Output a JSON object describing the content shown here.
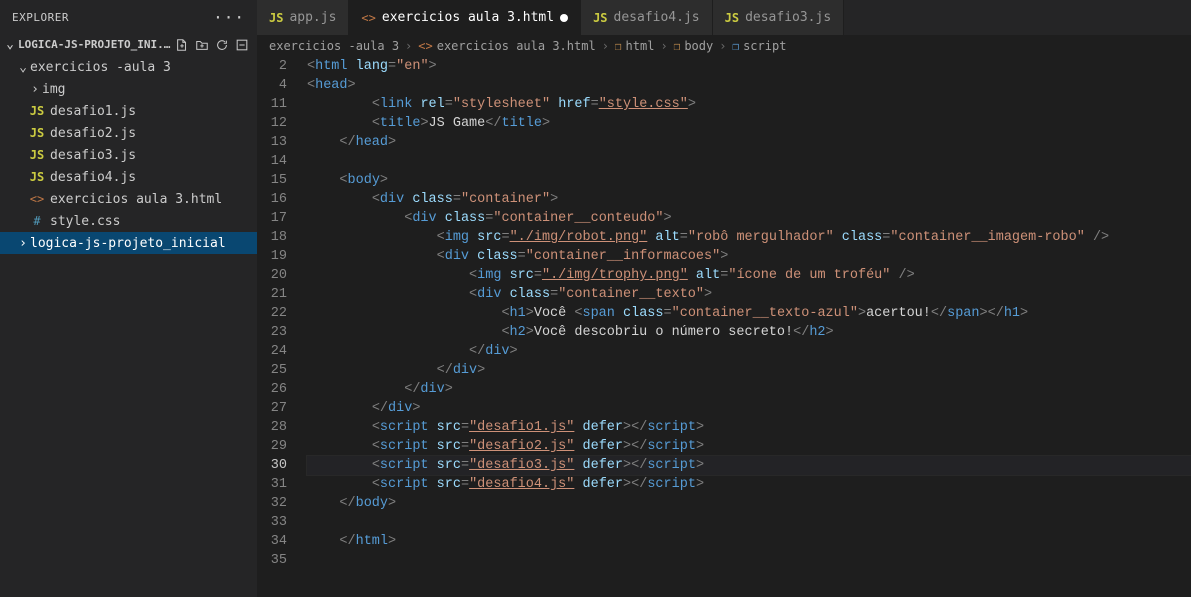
{
  "sidebar": {
    "title": "EXPLORER",
    "project": "LOGICA-JS-PROJETO_INI...",
    "folder": "exercicios -aula 3",
    "items": [
      {
        "label": "img",
        "type": "folder"
      },
      {
        "label": "desafio1.js",
        "type": "js"
      },
      {
        "label": "desafio2.js",
        "type": "js"
      },
      {
        "label": "desafio3.js",
        "type": "js"
      },
      {
        "label": "desafio4.js",
        "type": "js"
      },
      {
        "label": "exercicios aula 3.html",
        "type": "html"
      },
      {
        "label": "style.css",
        "type": "css"
      }
    ],
    "selected": "logica-js-projeto_inicial"
  },
  "tabs": [
    {
      "label": "app.js",
      "type": "js",
      "active": false,
      "dirty": false
    },
    {
      "label": "exercicios aula 3.html",
      "type": "html",
      "active": true,
      "dirty": true
    },
    {
      "label": "desafio4.js",
      "type": "js",
      "active": false,
      "dirty": false
    },
    {
      "label": "desafio3.js",
      "type": "js",
      "active": false,
      "dirty": false
    }
  ],
  "breadcrumbs": [
    {
      "label": "exercicios -aula 3",
      "icon": ""
    },
    {
      "label": "exercicios aula 3.html",
      "icon": "html"
    },
    {
      "label": "html",
      "icon": "cube"
    },
    {
      "label": "body",
      "icon": "cube"
    },
    {
      "label": "script",
      "icon": "cube-b"
    }
  ],
  "code": {
    "lineNumbers": [
      2,
      4,
      11,
      12,
      13,
      14,
      15,
      16,
      17,
      18,
      19,
      20,
      21,
      22,
      23,
      24,
      25,
      26,
      27,
      28,
      29,
      30,
      31,
      32,
      33,
      34,
      35
    ],
    "activeLine": 30,
    "lines": [
      {
        "n": 2,
        "tokens": [
          {
            "c": "punc",
            "t": "<"
          },
          {
            "c": "tag",
            "t": "html"
          },
          {
            "c": "txt",
            "t": " "
          },
          {
            "c": "attr",
            "t": "lang"
          },
          {
            "c": "punc",
            "t": "="
          },
          {
            "c": "string",
            "t": "\"en\""
          },
          {
            "c": "punc",
            "t": ">"
          }
        ]
      },
      {
        "n": 4,
        "tokens": [
          {
            "c": "punc",
            "t": "<"
          },
          {
            "c": "tag",
            "t": "head"
          },
          {
            "c": "punc",
            "t": ">"
          }
        ]
      },
      {
        "n": 11,
        "indent": 2,
        "tokens": [
          {
            "c": "punc",
            "t": "<"
          },
          {
            "c": "tag",
            "t": "link"
          },
          {
            "c": "txt",
            "t": " "
          },
          {
            "c": "attr",
            "t": "rel"
          },
          {
            "c": "punc",
            "t": "="
          },
          {
            "c": "string",
            "t": "\"stylesheet\""
          },
          {
            "c": "txt",
            "t": " "
          },
          {
            "c": "attr",
            "t": "href"
          },
          {
            "c": "punc",
            "t": "="
          },
          {
            "c": "string link",
            "t": "\"style.css\""
          },
          {
            "c": "punc",
            "t": ">"
          }
        ]
      },
      {
        "n": 12,
        "indent": 2,
        "tokens": [
          {
            "c": "punc",
            "t": "<"
          },
          {
            "c": "tag",
            "t": "title"
          },
          {
            "c": "punc",
            "t": ">"
          },
          {
            "c": "txt",
            "t": "JS Game"
          },
          {
            "c": "punc",
            "t": "</"
          },
          {
            "c": "tag",
            "t": "title"
          },
          {
            "c": "punc",
            "t": ">"
          }
        ]
      },
      {
        "n": 13,
        "indent": 1,
        "tokens": [
          {
            "c": "punc",
            "t": "</"
          },
          {
            "c": "tag",
            "t": "head"
          },
          {
            "c": "punc",
            "t": ">"
          }
        ]
      },
      {
        "n": 14,
        "tokens": []
      },
      {
        "n": 15,
        "indent": 1,
        "tokens": [
          {
            "c": "punc",
            "t": "<"
          },
          {
            "c": "tag",
            "t": "body"
          },
          {
            "c": "punc",
            "t": ">"
          }
        ]
      },
      {
        "n": 16,
        "indent": 2,
        "tokens": [
          {
            "c": "punc",
            "t": "<"
          },
          {
            "c": "tag",
            "t": "div"
          },
          {
            "c": "txt",
            "t": " "
          },
          {
            "c": "attr",
            "t": "class"
          },
          {
            "c": "punc",
            "t": "="
          },
          {
            "c": "string",
            "t": "\"container\""
          },
          {
            "c": "punc",
            "t": ">"
          }
        ]
      },
      {
        "n": 17,
        "indent": 3,
        "tokens": [
          {
            "c": "punc",
            "t": "<"
          },
          {
            "c": "tag",
            "t": "div"
          },
          {
            "c": "txt",
            "t": " "
          },
          {
            "c": "attr",
            "t": "class"
          },
          {
            "c": "punc",
            "t": "="
          },
          {
            "c": "string",
            "t": "\"container__conteudo\""
          },
          {
            "c": "punc",
            "t": ">"
          }
        ]
      },
      {
        "n": 18,
        "indent": 4,
        "tokens": [
          {
            "c": "punc",
            "t": "<"
          },
          {
            "c": "tag",
            "t": "img"
          },
          {
            "c": "txt",
            "t": " "
          },
          {
            "c": "attr",
            "t": "src"
          },
          {
            "c": "punc",
            "t": "="
          },
          {
            "c": "string link",
            "t": "\"./img/robot.png\""
          },
          {
            "c": "txt",
            "t": " "
          },
          {
            "c": "attr",
            "t": "alt"
          },
          {
            "c": "punc",
            "t": "="
          },
          {
            "c": "string",
            "t": "\"robô mergulhador\""
          },
          {
            "c": "txt",
            "t": " "
          },
          {
            "c": "attr",
            "t": "class"
          },
          {
            "c": "punc",
            "t": "="
          },
          {
            "c": "string",
            "t": "\"container__imagem-robo\""
          },
          {
            "c": "txt",
            "t": " "
          },
          {
            "c": "punc",
            "t": "/>"
          }
        ]
      },
      {
        "n": 19,
        "indent": 4,
        "tokens": [
          {
            "c": "punc",
            "t": "<"
          },
          {
            "c": "tag",
            "t": "div"
          },
          {
            "c": "txt",
            "t": " "
          },
          {
            "c": "attr",
            "t": "class"
          },
          {
            "c": "punc",
            "t": "="
          },
          {
            "c": "string",
            "t": "\"container__informacoes\""
          },
          {
            "c": "punc",
            "t": ">"
          }
        ]
      },
      {
        "n": 20,
        "indent": 5,
        "tokens": [
          {
            "c": "punc",
            "t": "<"
          },
          {
            "c": "tag",
            "t": "img"
          },
          {
            "c": "txt",
            "t": " "
          },
          {
            "c": "attr",
            "t": "src"
          },
          {
            "c": "punc",
            "t": "="
          },
          {
            "c": "string link",
            "t": "\"./img/trophy.png\""
          },
          {
            "c": "txt",
            "t": " "
          },
          {
            "c": "attr",
            "t": "alt"
          },
          {
            "c": "punc",
            "t": "="
          },
          {
            "c": "string",
            "t": "\"ícone de um troféu\""
          },
          {
            "c": "txt",
            "t": " "
          },
          {
            "c": "punc",
            "t": "/>"
          }
        ]
      },
      {
        "n": 21,
        "indent": 5,
        "tokens": [
          {
            "c": "punc",
            "t": "<"
          },
          {
            "c": "tag",
            "t": "div"
          },
          {
            "c": "txt",
            "t": " "
          },
          {
            "c": "attr",
            "t": "class"
          },
          {
            "c": "punc",
            "t": "="
          },
          {
            "c": "string",
            "t": "\"container__texto\""
          },
          {
            "c": "punc",
            "t": ">"
          }
        ]
      },
      {
        "n": 22,
        "indent": 6,
        "tokens": [
          {
            "c": "punc",
            "t": "<"
          },
          {
            "c": "tag",
            "t": "h1"
          },
          {
            "c": "punc",
            "t": ">"
          },
          {
            "c": "txt",
            "t": "Você "
          },
          {
            "c": "punc",
            "t": "<"
          },
          {
            "c": "tag",
            "t": "span"
          },
          {
            "c": "txt",
            "t": " "
          },
          {
            "c": "attr",
            "t": "class"
          },
          {
            "c": "punc",
            "t": "="
          },
          {
            "c": "string",
            "t": "\"container__texto-azul\""
          },
          {
            "c": "punc",
            "t": ">"
          },
          {
            "c": "txt",
            "t": "acertou!"
          },
          {
            "c": "punc",
            "t": "</"
          },
          {
            "c": "tag",
            "t": "span"
          },
          {
            "c": "punc",
            "t": ">"
          },
          {
            "c": "punc",
            "t": "</"
          },
          {
            "c": "tag",
            "t": "h1"
          },
          {
            "c": "punc",
            "t": ">"
          }
        ]
      },
      {
        "n": 23,
        "indent": 6,
        "tokens": [
          {
            "c": "punc",
            "t": "<"
          },
          {
            "c": "tag",
            "t": "h2"
          },
          {
            "c": "punc",
            "t": ">"
          },
          {
            "c": "txt",
            "t": "Você descobriu o número secreto!"
          },
          {
            "c": "punc",
            "t": "</"
          },
          {
            "c": "tag",
            "t": "h2"
          },
          {
            "c": "punc",
            "t": ">"
          }
        ]
      },
      {
        "n": 24,
        "indent": 5,
        "tokens": [
          {
            "c": "punc",
            "t": "</"
          },
          {
            "c": "tag",
            "t": "div"
          },
          {
            "c": "punc",
            "t": ">"
          }
        ]
      },
      {
        "n": 25,
        "indent": 4,
        "tokens": [
          {
            "c": "punc",
            "t": "</"
          },
          {
            "c": "tag",
            "t": "div"
          },
          {
            "c": "punc",
            "t": ">"
          }
        ]
      },
      {
        "n": 26,
        "indent": 3,
        "tokens": [
          {
            "c": "punc",
            "t": "</"
          },
          {
            "c": "tag",
            "t": "div"
          },
          {
            "c": "punc",
            "t": ">"
          }
        ]
      },
      {
        "n": 27,
        "indent": 2,
        "tokens": [
          {
            "c": "punc",
            "t": "</"
          },
          {
            "c": "tag",
            "t": "div"
          },
          {
            "c": "punc",
            "t": ">"
          }
        ]
      },
      {
        "n": 28,
        "indent": 2,
        "tokens": [
          {
            "c": "punc",
            "t": "<"
          },
          {
            "c": "tag",
            "t": "script"
          },
          {
            "c": "txt",
            "t": " "
          },
          {
            "c": "attr",
            "t": "src"
          },
          {
            "c": "punc",
            "t": "="
          },
          {
            "c": "string link",
            "t": "\"desafio1.js\""
          },
          {
            "c": "txt",
            "t": " "
          },
          {
            "c": "attr",
            "t": "defer"
          },
          {
            "c": "punc",
            "t": ">"
          },
          {
            "c": "punc",
            "t": "</"
          },
          {
            "c": "tag",
            "t": "script"
          },
          {
            "c": "punc",
            "t": ">"
          }
        ]
      },
      {
        "n": 29,
        "indent": 2,
        "tokens": [
          {
            "c": "punc",
            "t": "<"
          },
          {
            "c": "tag",
            "t": "script"
          },
          {
            "c": "txt",
            "t": " "
          },
          {
            "c": "attr",
            "t": "src"
          },
          {
            "c": "punc",
            "t": "="
          },
          {
            "c": "string link",
            "t": "\"desafio2.js\""
          },
          {
            "c": "txt",
            "t": " "
          },
          {
            "c": "attr",
            "t": "defer"
          },
          {
            "c": "punc",
            "t": ">"
          },
          {
            "c": "punc",
            "t": "</"
          },
          {
            "c": "tag",
            "t": "script"
          },
          {
            "c": "punc",
            "t": ">"
          }
        ]
      },
      {
        "n": 30,
        "indent": 2,
        "active": true,
        "tokens": [
          {
            "c": "punc",
            "t": "<"
          },
          {
            "c": "tag",
            "t": "script"
          },
          {
            "c": "txt",
            "t": " "
          },
          {
            "c": "attr",
            "t": "src"
          },
          {
            "c": "punc",
            "t": "="
          },
          {
            "c": "string link",
            "t": "\"desafio3.js\""
          },
          {
            "c": "txt",
            "t": " "
          },
          {
            "c": "attr",
            "t": "defer"
          },
          {
            "c": "punc",
            "t": ">"
          },
          {
            "c": "punc",
            "t": "</"
          },
          {
            "c": "tag",
            "t": "script"
          },
          {
            "c": "punc",
            "t": ">"
          }
        ]
      },
      {
        "n": 31,
        "indent": 2,
        "tokens": [
          {
            "c": "punc",
            "t": "<"
          },
          {
            "c": "tag",
            "t": "script"
          },
          {
            "c": "txt",
            "t": " "
          },
          {
            "c": "attr",
            "t": "src"
          },
          {
            "c": "punc",
            "t": "="
          },
          {
            "c": "string link",
            "t": "\"desafio4.js\""
          },
          {
            "c": "txt",
            "t": " "
          },
          {
            "c": "attr",
            "t": "defer"
          },
          {
            "c": "punc",
            "t": ">"
          },
          {
            "c": "punc",
            "t": "</"
          },
          {
            "c": "tag",
            "t": "script"
          },
          {
            "c": "punc",
            "t": ">"
          }
        ]
      },
      {
        "n": 32,
        "indent": 1,
        "tokens": [
          {
            "c": "punc",
            "t": "</"
          },
          {
            "c": "tag",
            "t": "body"
          },
          {
            "c": "punc",
            "t": ">"
          }
        ]
      },
      {
        "n": 33,
        "tokens": []
      },
      {
        "n": 34,
        "indent": 1,
        "tokens": [
          {
            "c": "punc",
            "t": "</"
          },
          {
            "c": "tag",
            "t": "html"
          },
          {
            "c": "punc",
            "t": ">"
          }
        ]
      },
      {
        "n": 35,
        "tokens": []
      }
    ]
  }
}
